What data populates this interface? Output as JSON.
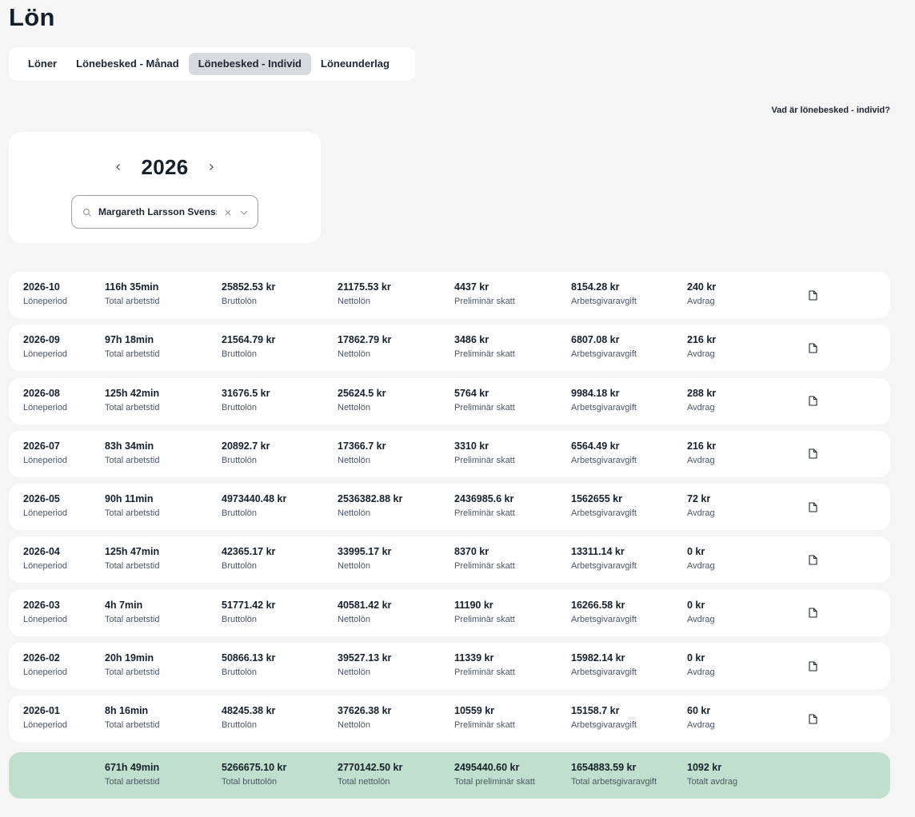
{
  "page": {
    "title": "Lön"
  },
  "tabs": [
    {
      "label": "Löner",
      "active": false
    },
    {
      "label": "Lönebesked - Månad",
      "active": false
    },
    {
      "label": "Lönebesked - Individ",
      "active": true
    },
    {
      "label": "Löneunderlag",
      "active": false
    }
  ],
  "help": {
    "link": "Vad är lönebesked - individ?"
  },
  "picker": {
    "year": "2026",
    "person": "Margareth  Larsson Svensson"
  },
  "labels": {
    "period": "Löneperiod",
    "time": "Total arbetstid",
    "gross": "Bruttolön",
    "net": "Nettolön",
    "tax": "Preliminär skatt",
    "employer": "Arbetsgivaravgift",
    "deduction": "Avdrag"
  },
  "rows": [
    {
      "period": "2026-10",
      "time": "116h 35min",
      "gross": "25852.53 kr",
      "net": "21175.53 kr",
      "tax": "4437 kr",
      "employer": "8154.28 kr",
      "deduction": "240 kr"
    },
    {
      "period": "2026-09",
      "time": "97h 18min",
      "gross": "21564.79 kr",
      "net": "17862.79 kr",
      "tax": "3486 kr",
      "employer": "6807.08 kr",
      "deduction": "216 kr"
    },
    {
      "period": "2026-08",
      "time": "125h 42min",
      "gross": "31676.5 kr",
      "net": "25624.5 kr",
      "tax": "5764 kr",
      "employer": "9984.18 kr",
      "deduction": "288 kr"
    },
    {
      "period": "2026-07",
      "time": "83h 34min",
      "gross": "20892.7 kr",
      "net": "17366.7 kr",
      "tax": "3310 kr",
      "employer": "6564.49 kr",
      "deduction": "216 kr"
    },
    {
      "period": "2026-05",
      "time": "90h 11min",
      "gross": "4973440.48 kr",
      "net": "2536382.88 kr",
      "tax": "2436985.6 kr",
      "employer": "1562655 kr",
      "deduction": "72 kr"
    },
    {
      "period": "2026-04",
      "time": "125h 47min",
      "gross": "42365.17 kr",
      "net": "33995.17 kr",
      "tax": "8370 kr",
      "employer": "13311.14 kr",
      "deduction": "0 kr"
    },
    {
      "period": "2026-03",
      "time": "4h 7min",
      "gross": "51771.42 kr",
      "net": "40581.42 kr",
      "tax": "11190 kr",
      "employer": "16266.58 kr",
      "deduction": "0 kr"
    },
    {
      "period": "2026-02",
      "time": "20h 19min",
      "gross": "50866.13 kr",
      "net": "39527.13 kr",
      "tax": "11339 kr",
      "employer": "15982.14 kr",
      "deduction": "0 kr"
    },
    {
      "period": "2026-01",
      "time": "8h 16min",
      "gross": "48245.38 kr",
      "net": "37626.38 kr",
      "tax": "10559 kr",
      "employer": "15158.7 kr",
      "deduction": "60 kr"
    }
  ],
  "totals": {
    "time": "671h 49min",
    "time_label": "Total arbetstid",
    "gross": "5266675.10 kr",
    "gross_label": "Total bruttolön",
    "net": "2770142.50 kr",
    "net_label": "Total nettolön",
    "tax": "2495440.60 kr",
    "tax_label": "Total preliminär skatt",
    "employer": "1654883.59 kr",
    "employer_label": "Total arbetsgivaravgift",
    "deduction": "1092 kr",
    "deduction_label": "Totalt avdrag"
  },
  "icons": {
    "search": "search-icon",
    "clear": "close-icon",
    "dropdown": "chevron-down-icon",
    "prev": "chevron-left-icon",
    "next": "chevron-right-icon",
    "document": "document-icon"
  },
  "colors": {
    "background": "#f5f5f5",
    "card": "#ffffff",
    "active_tab": "#d6d9dd",
    "totals": "#c1dfcd",
    "text": "#16202b"
  }
}
